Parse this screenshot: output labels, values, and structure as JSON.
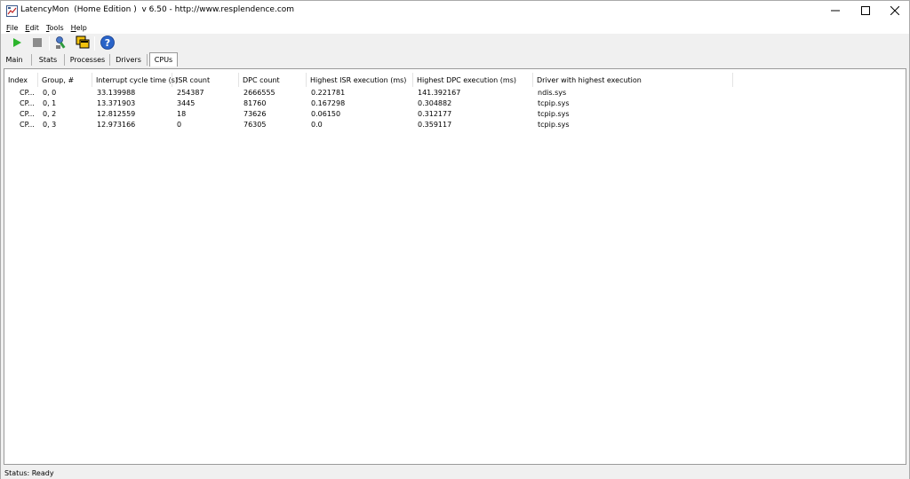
{
  "window": {
    "title": "LatencyMon  (Home Edition )  v 6.50 - http://www.resplendence.com"
  },
  "menu": [
    {
      "label": "File",
      "accel": "F",
      "rest": "ile"
    },
    {
      "label": "Edit",
      "accel": "E",
      "rest": "dit"
    },
    {
      "label": "Tools",
      "accel": "T",
      "rest": "ools"
    },
    {
      "label": "Help",
      "accel": "H",
      "rest": "elp"
    }
  ],
  "toolbar": {
    "icons": [
      "play-icon",
      "stop-icon",
      "wrench-icon",
      "windows-icon",
      "help-icon"
    ],
    "play_color": "#2db52d",
    "stop_color": "#8c8c8c"
  },
  "tabs": [
    "Main",
    "Stats",
    "Processes",
    "Drivers",
    "CPUs"
  ],
  "active_tab": "CPUs",
  "table": {
    "headers": [
      "Index",
      "Group, #",
      "Interrupt cycle time (s)",
      "ISR count",
      "DPC count",
      "Highest ISR execution (ms)",
      "Highest DPC execution (ms)",
      "Driver with highest execution"
    ],
    "rows": [
      [
        "CP...",
        "0, 0",
        "33.139988",
        "254387",
        "2666555",
        "0.221781",
        "141.392167",
        "ndis.sys"
      ],
      [
        "CP...",
        "0, 1",
        "13.371903",
        "3445",
        "81760",
        "0.167298",
        "0.304882",
        "tcpip.sys"
      ],
      [
        "CP...",
        "0, 2",
        "12.812559",
        "18",
        "73626",
        "0.06150",
        "0.312177",
        "tcpip.sys"
      ],
      [
        "CP...",
        "0, 3",
        "12.973166",
        "0",
        "76305",
        "0.0",
        "0.359117",
        "tcpip.sys"
      ]
    ]
  },
  "status": "Status: Ready"
}
